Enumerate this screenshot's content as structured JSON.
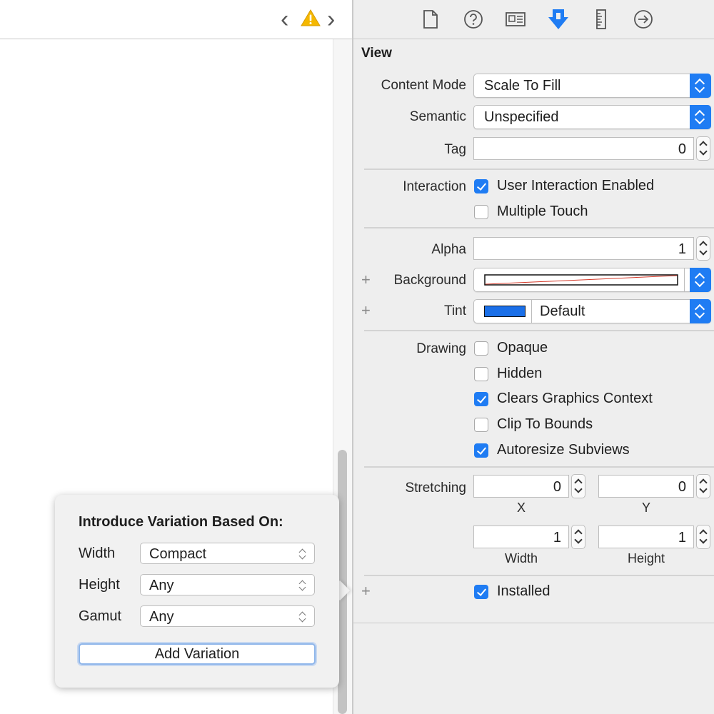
{
  "editor": {
    "nav_back_glyph": "‹",
    "nav_forward_glyph": "›",
    "warning_icon": "warning-icon",
    "warning_color": "#f5b800"
  },
  "inspector_tabs": [
    {
      "icon": "file-icon",
      "active": false
    },
    {
      "icon": "help-icon",
      "active": false
    },
    {
      "icon": "identity-icon",
      "active": false
    },
    {
      "icon": "attributes-icon",
      "active": true
    },
    {
      "icon": "ruler-icon",
      "active": false
    },
    {
      "icon": "connections-icon",
      "active": false
    }
  ],
  "view": {
    "section_title": "View",
    "content_mode": {
      "label": "Content Mode",
      "value": "Scale To Fill"
    },
    "semantic": {
      "label": "Semantic",
      "value": "Unspecified"
    },
    "tag": {
      "label": "Tag",
      "value": "0"
    },
    "interaction": {
      "label": "Interaction",
      "user_interaction": {
        "label": "User Interaction Enabled",
        "checked": true
      },
      "multiple_touch": {
        "label": "Multiple Touch",
        "checked": false
      }
    },
    "alpha": {
      "label": "Alpha",
      "value": "1"
    },
    "background": {
      "label": "Background",
      "plus": "+"
    },
    "tint": {
      "label": "Tint",
      "plus": "+",
      "value": "Default",
      "swatch_color": "#1a6fe8"
    },
    "drawing": {
      "label": "Drawing",
      "opaque": {
        "label": "Opaque",
        "checked": false
      },
      "hidden": {
        "label": "Hidden",
        "checked": false
      },
      "clears_graphics": {
        "label": "Clears Graphics Context",
        "checked": true
      },
      "clip_to_bounds": {
        "label": "Clip To Bounds",
        "checked": false
      },
      "autoresize": {
        "label": "Autoresize Subviews",
        "checked": true
      }
    },
    "stretching": {
      "label": "Stretching",
      "x": {
        "value": "0",
        "caption": "X"
      },
      "y": {
        "value": "0",
        "caption": "Y"
      },
      "width": {
        "value": "1",
        "caption": "Width"
      },
      "height": {
        "value": "1",
        "caption": "Height"
      }
    },
    "installed": {
      "plus": "+",
      "label": "Installed",
      "checked": true
    }
  },
  "popover": {
    "title": "Introduce Variation Based On:",
    "width": {
      "label": "Width",
      "value": "Compact"
    },
    "height": {
      "label": "Height",
      "value": "Any"
    },
    "gamut": {
      "label": "Gamut",
      "value": "Any"
    },
    "button": "Add Variation"
  },
  "colors": {
    "accent": "#1f7cf3",
    "inspector_bg": "#eeeeee"
  }
}
